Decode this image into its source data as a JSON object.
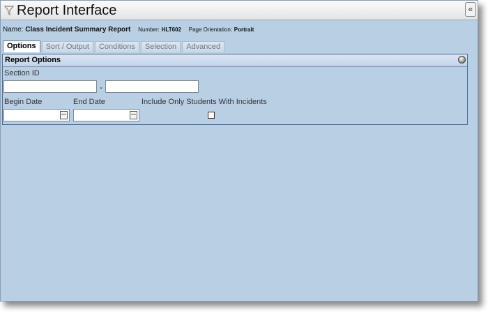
{
  "window": {
    "title": "Report Interface",
    "collapse_label": "«"
  },
  "report": {
    "name_label": "Name:",
    "name": "Class Incident Summary Report",
    "number_label": "Number:",
    "number": "HLT602",
    "orientation_label": "Page Orientation:",
    "orientation": "Portrait"
  },
  "tabs": [
    {
      "label": "Options",
      "active": true
    },
    {
      "label": "Sort / Output",
      "active": false
    },
    {
      "label": "Conditions",
      "active": false
    },
    {
      "label": "Selection",
      "active": false
    },
    {
      "label": "Advanced",
      "active": false
    }
  ],
  "panel": {
    "title": "Report Options",
    "section_id_label": "Section ID",
    "section_from": "",
    "range_separator": "-",
    "section_to": "",
    "begin_date_label": "Begin Date",
    "begin_date": "",
    "end_date_label": "End Date",
    "end_date": "",
    "include_label": "Include Only Students With Incidents",
    "include_checked": false
  }
}
